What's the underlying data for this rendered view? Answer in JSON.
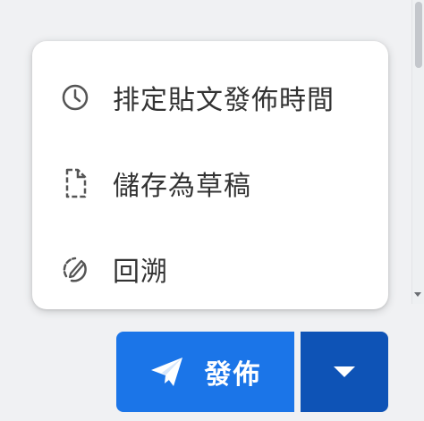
{
  "menu": {
    "items": [
      {
        "label": "排定貼文發佈時間",
        "icon": "clock-icon"
      },
      {
        "label": "儲存為草稿",
        "icon": "draft-document-icon"
      },
      {
        "label": "回溯",
        "icon": "backdate-icon"
      }
    ]
  },
  "actions": {
    "publish_label": "發佈",
    "publish_icon": "send-icon",
    "dropdown_icon": "caret-down-icon"
  },
  "colors": {
    "publish_bg": "#1b75e8",
    "dropdown_bg": "#0e53b6",
    "text": "#333333",
    "icon": "#555555"
  }
}
